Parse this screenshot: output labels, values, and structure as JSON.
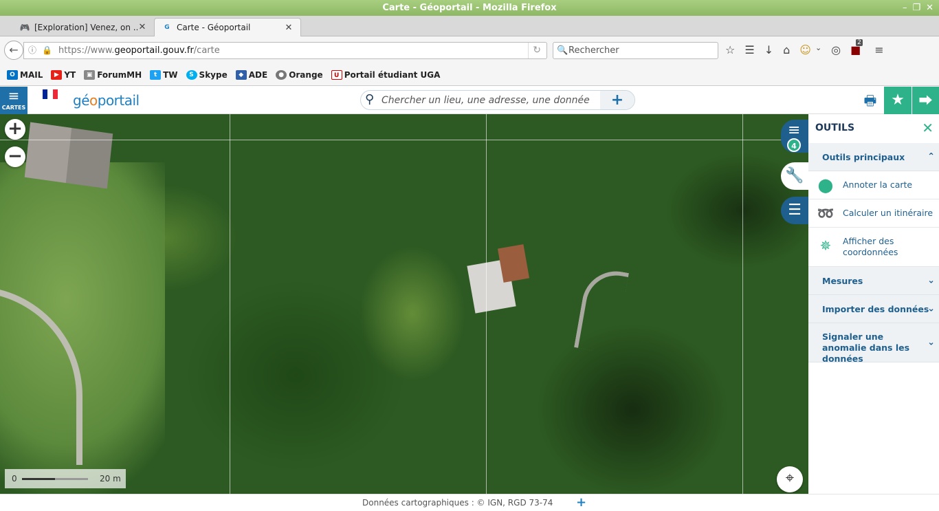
{
  "window": {
    "title": "Carte - Géoportail - Mozilla Firefox"
  },
  "tabs": [
    {
      "label": "[Exploration] Venez, on ...",
      "icon": "gamepad-icon"
    },
    {
      "label": "Carte - Géoportail",
      "icon": "geoportail-icon"
    }
  ],
  "navbar": {
    "url_prefix": "https://www.",
    "url_domain": "geoportail.gouv.fr",
    "url_path": "/carte",
    "search_placeholder": "Rechercher",
    "badge_count": "2"
  },
  "bookmarks": [
    {
      "label": "MAIL",
      "icon": "outlook-icon",
      "color": "#0072c6"
    },
    {
      "label": "YT",
      "icon": "youtube-icon",
      "color": "#e62117"
    },
    {
      "label": "ForumMH",
      "icon": "gamepad-icon",
      "color": "#666666"
    },
    {
      "label": "TW",
      "icon": "twitter-icon",
      "color": "#1da1f2"
    },
    {
      "label": "Skype",
      "icon": "skype-icon",
      "color": "#00aff0"
    },
    {
      "label": "ADE",
      "icon": "ade-icon",
      "color": "#3060a8"
    },
    {
      "label": "Orange",
      "icon": "globe-icon",
      "color": "#777777"
    },
    {
      "label": "Portail étudiant UGA",
      "icon": "uga-icon",
      "color": "#c00000"
    }
  ],
  "geoportail": {
    "menu_label": "CARTES",
    "brand_pre": "gé",
    "brand_o": "o",
    "brand_post": "portail",
    "search_placeholder": "Chercher un lieu, une adresse, une donnée",
    "layers_count": "4",
    "accent_color": "#2db28a",
    "primary_color": "#1f5f8e"
  },
  "map": {
    "scale_start": "0",
    "scale_end": "20 m",
    "scale_fill": 0.5
  },
  "tools_panel": {
    "title": "OUTILS",
    "main_section": "Outils principaux",
    "items": [
      {
        "label": "Annoter la carte",
        "icon": "map-pin-icon"
      },
      {
        "label": "Calculer un itinéraire",
        "icon": "route-icon"
      },
      {
        "label": "Afficher des coordonnées",
        "icon": "axes-icon"
      }
    ],
    "sections": [
      {
        "label": "Mesures"
      },
      {
        "label": "Importer des données"
      },
      {
        "label": "Signaler une anomalie dans les données"
      }
    ]
  },
  "footer": {
    "attribution": "Données cartographiques : ©  IGN,   RGD 73-74"
  }
}
